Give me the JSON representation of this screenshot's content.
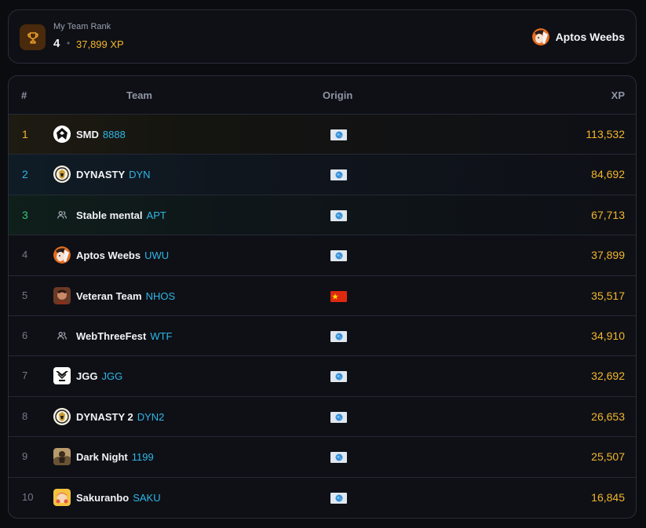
{
  "my_rank": {
    "label": "My Team Rank",
    "rank": "4",
    "separator": "•",
    "xp": "37,899 XP",
    "team_name": "Aptos Weebs"
  },
  "table": {
    "headers": {
      "rank": "#",
      "team": "Team",
      "origin": "Origin",
      "xp": "XP"
    },
    "rows": [
      {
        "rank": "1",
        "name": "SMD",
        "tag": "8888",
        "xp": "113,532",
        "avatar": "smd-logo-icon",
        "origin": "globe-flag-icon"
      },
      {
        "rank": "2",
        "name": "DYNASTY",
        "tag": "DYN",
        "xp": "84,692",
        "avatar": "dynasty-logo-icon",
        "origin": "globe-flag-icon"
      },
      {
        "rank": "3",
        "name": "Stable mental",
        "tag": "APT",
        "xp": "67,713",
        "avatar": "users-icon",
        "origin": "globe-flag-icon"
      },
      {
        "rank": "4",
        "name": "Aptos Weebs",
        "tag": "UWU",
        "xp": "37,899",
        "avatar": "anime-avatar-icon",
        "origin": "globe-flag-icon"
      },
      {
        "rank": "5",
        "name": "Veteran Team",
        "tag": "NHOS",
        "xp": "35,517",
        "avatar": "veteran-avatar-icon",
        "origin": "china-flag-icon"
      },
      {
        "rank": "6",
        "name": "WebThreeFest",
        "tag": "WTF",
        "xp": "34,910",
        "avatar": "users-icon",
        "origin": "globe-flag-icon"
      },
      {
        "rank": "7",
        "name": "JGG",
        "tag": "JGG",
        "xp": "32,692",
        "avatar": "jgg-logo-icon",
        "origin": "globe-flag-icon"
      },
      {
        "rank": "8",
        "name": "DYNASTY 2",
        "tag": "DYN2",
        "xp": "26,653",
        "avatar": "dynasty-logo-icon",
        "origin": "globe-flag-icon"
      },
      {
        "rank": "9",
        "name": "Dark Night",
        "tag": "1199",
        "xp": "25,507",
        "avatar": "dark-night-avatar-icon",
        "origin": "globe-flag-icon"
      },
      {
        "rank": "10",
        "name": "Sakuranbo",
        "tag": "SAKU",
        "xp": "16,845",
        "avatar": "sakuranbo-avatar-icon",
        "origin": "globe-flag-icon"
      }
    ]
  },
  "colors": {
    "background": "#0b0c10",
    "panel": "#0e1016",
    "border": "#2a2e3a",
    "xp_gold": "#f4b62b",
    "tag_cyan": "#2fb6e6",
    "rank3_green": "#34c77b"
  }
}
